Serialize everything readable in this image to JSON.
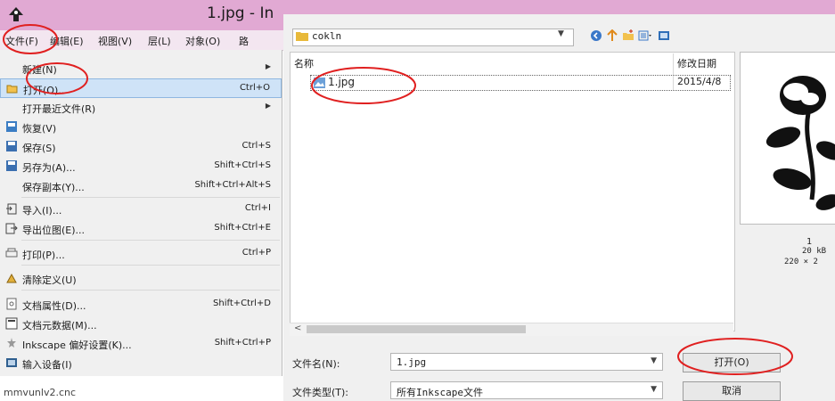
{
  "inkscape": {
    "title": "1.jpg - In",
    "menubar": [
      "文件(F)",
      "编辑(E)",
      "视图(V)",
      "层(L)",
      "对象(O)",
      "路"
    ],
    "file_menu": [
      {
        "label": "新建(N)",
        "shortcut": "",
        "submenu": true,
        "icon": "none"
      },
      {
        "label": "打开(O)...",
        "shortcut": "Ctrl+O",
        "submenu": false,
        "icon": "open-icon"
      },
      {
        "label": "打开最近文件(R)",
        "shortcut": "",
        "submenu": true,
        "icon": "none"
      },
      {
        "label": "恢复(V)",
        "shortcut": "",
        "submenu": false,
        "icon": "revert-icon"
      },
      {
        "label": "保存(S)",
        "shortcut": "Ctrl+S",
        "submenu": false,
        "icon": "save-icon"
      },
      {
        "label": "另存为(A)...",
        "shortcut": "Shift+Ctrl+S",
        "submenu": false,
        "icon": "save-as-icon"
      },
      {
        "label": "保存副本(Y)...",
        "shortcut": "Shift+Ctrl+Alt+S",
        "submenu": false,
        "icon": "none"
      },
      {
        "label": "导入(I)...",
        "shortcut": "Ctrl+I",
        "submenu": false,
        "icon": "import-icon"
      },
      {
        "label": "导出位图(E)...",
        "shortcut": "Shift+Ctrl+E",
        "submenu": false,
        "icon": "export-icon"
      },
      {
        "label": "打印(P)...",
        "shortcut": "Ctrl+P",
        "submenu": false,
        "icon": "print-icon"
      },
      {
        "label": "清除定义(U)",
        "shortcut": "",
        "submenu": false,
        "icon": "vacuum-icon"
      },
      {
        "label": "文档属性(D)...",
        "shortcut": "Shift+Ctrl+D",
        "submenu": false,
        "icon": "document-properties-icon"
      },
      {
        "label": "文档元数据(M)...",
        "shortcut": "",
        "submenu": false,
        "icon": "metadata-icon"
      },
      {
        "label": "Inkscape 偏好设置(K)...",
        "shortcut": "Shift+Ctrl+P",
        "submenu": false,
        "icon": "preferences-icon"
      },
      {
        "label": "输入设备(I)",
        "shortcut": "",
        "submenu": false,
        "icon": "input-device-icon"
      }
    ],
    "bottom_text": "mmvunlv2.cnc"
  },
  "dialog": {
    "path": "cokln",
    "columns": {
      "name": "名称",
      "date": "修改日期"
    },
    "files": [
      {
        "name": "1.jpg",
        "date": "2015/4/8"
      }
    ],
    "preview": {
      "name": "1",
      "size": "20 kB",
      "dimensions": "220 × 2"
    },
    "filename_label": "文件名(N):",
    "filename_value": "1.jpg",
    "filetype_label": "文件类型(T):",
    "filetype_value": "所有Inkscape文件",
    "open_button": "打开(O)",
    "cancel_button": "取消"
  },
  "colors": {
    "titlebar": "#e1a9d3",
    "highlight": "#cfe3f7",
    "annotation": "#e02020"
  }
}
